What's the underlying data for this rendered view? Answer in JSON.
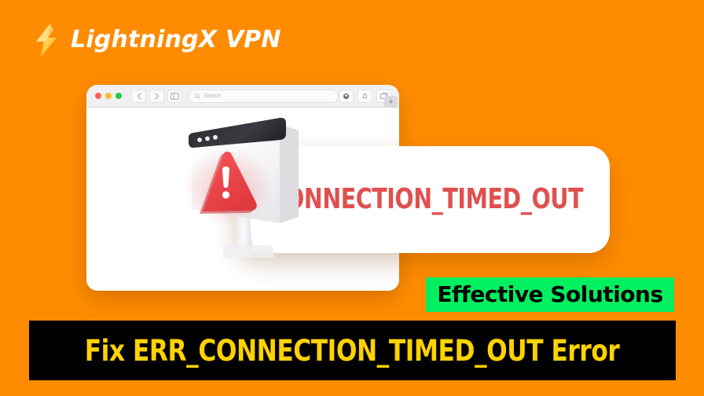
{
  "background_color": "#FF8C00",
  "brand": {
    "icon": "lightning-bolt-icon",
    "name": "LightningX VPN",
    "text_color": "#FFFFFF",
    "bolt_color": "#FFD24A"
  },
  "browser": {
    "traffic_lights": [
      {
        "name": "close",
        "color": "#FF5F57"
      },
      {
        "name": "minimize",
        "color": "#FFBD2E"
      },
      {
        "name": "maximize",
        "color": "#28C840"
      }
    ],
    "nav_buttons": [
      {
        "name": "back-button",
        "glyph": "‹"
      },
      {
        "name": "forward-button",
        "glyph": "›"
      },
      {
        "name": "sidebar-button",
        "glyph": "sidebar-icon"
      }
    ],
    "search": {
      "icon": "search-icon",
      "placeholder": "Search",
      "value": ""
    },
    "toolbar_buttons": [
      {
        "name": "share-button",
        "glyph": "share-icon"
      },
      {
        "name": "downloads-button",
        "glyph": "downloads-icon"
      },
      {
        "name": "tab-overview-button",
        "glyph": "tab-overview-icon"
      }
    ],
    "new_tab_label": "+"
  },
  "illustration": {
    "name": "error-window-illustration",
    "warning_icon": "warning-triangle-icon",
    "warning_color": "#F04545",
    "window_titlebar_color": "#303034",
    "dot_count": 3
  },
  "error_card": {
    "code": "ERR_CONNECTION_TIMED_OUT",
    "text_color": "#E0504F",
    "background": "#FFFFFF"
  },
  "badge": {
    "label": "Effective Solutions",
    "background": "#00F060",
    "text_color": "#000000"
  },
  "banner": {
    "headline": "Fix ERR_CONNECTION_TIMED_OUT Error",
    "background": "#000000",
    "text_color": "#FFD200"
  }
}
